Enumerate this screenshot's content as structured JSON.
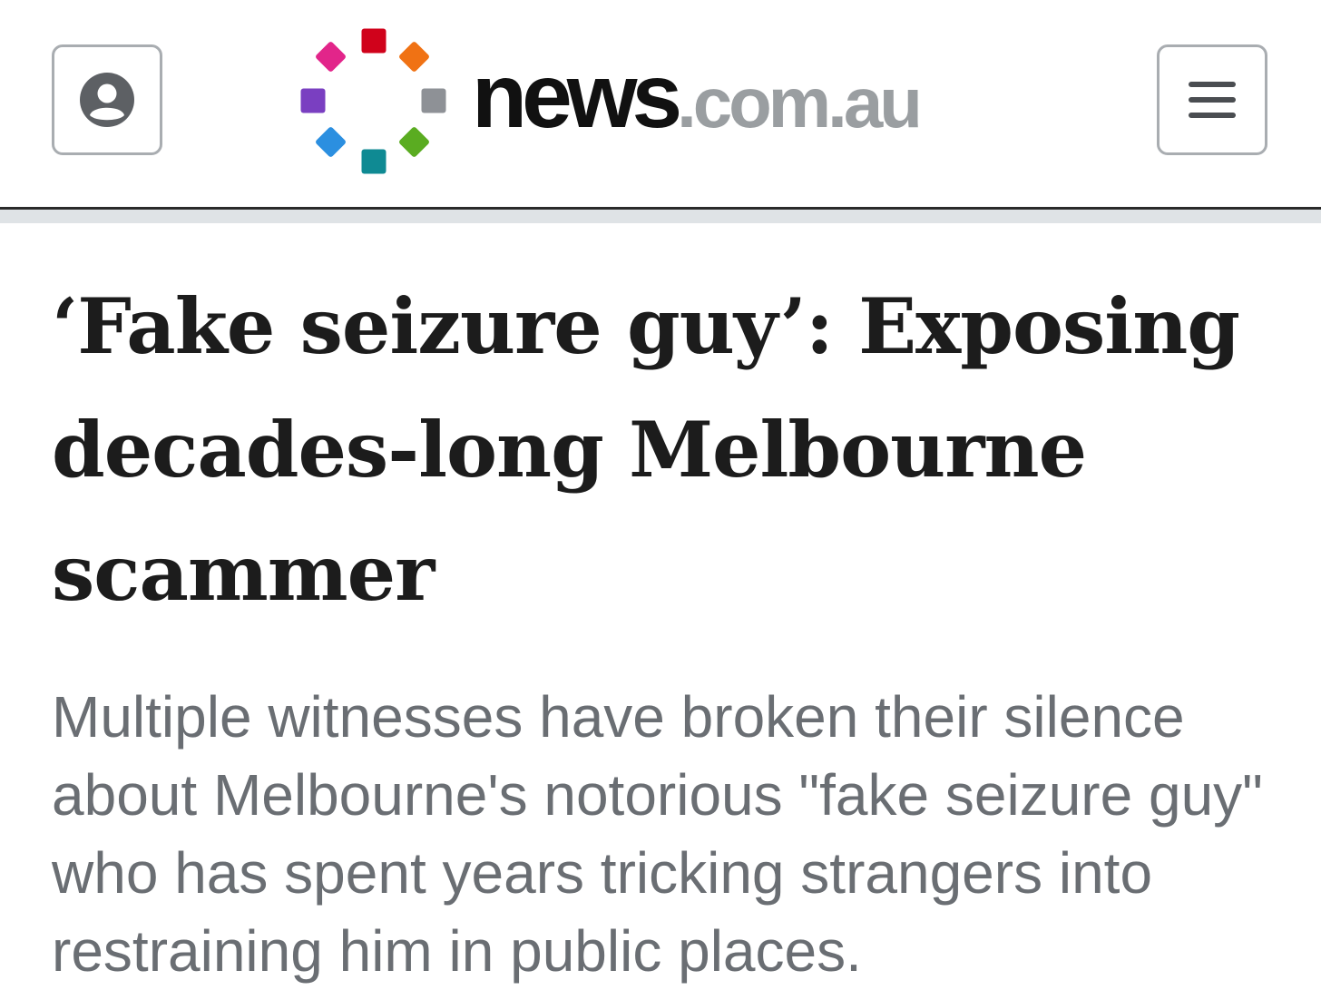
{
  "header": {
    "logo": {
      "brand": "news",
      "domain": ".com.au",
      "dot_colors": [
        "#d0021b",
        "#f07214",
        "#8e9196",
        "#5aac21",
        "#0f8a93",
        "#2b8fe0",
        "#7a3fc1",
        "#e2258a"
      ]
    },
    "account_icon": "user-circle-icon",
    "menu_icon": "hamburger-menu-icon"
  },
  "article": {
    "headline": "‘Fake seizure guy’: Exposing decades-long Melbourne scammer",
    "standfirst": "Multiple witnesses have broken their silence about Melbourne's notorious \"fake seizure guy\" who has spent years tricking strangers into restraining him in public places."
  }
}
